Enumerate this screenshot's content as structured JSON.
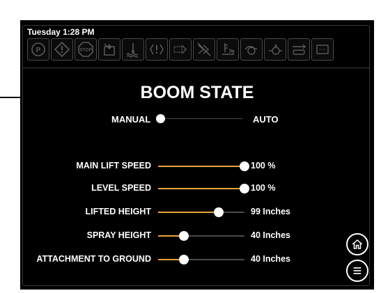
{
  "header": {
    "datetime": "Tuesday 1:28 PM",
    "status_icons": [
      {
        "name": "parking-brake-icon"
      },
      {
        "name": "warning-icon"
      },
      {
        "name": "stop-icon",
        "text": "STOP"
      },
      {
        "name": "fuel-icon"
      },
      {
        "name": "coolant-temp-icon"
      },
      {
        "name": "transmission-icon"
      },
      {
        "name": "hydraulic-icon"
      },
      {
        "name": "hydraulic-disabled-icon"
      },
      {
        "name": "oil-level-icon"
      },
      {
        "name": "engine-icon"
      },
      {
        "name": "oil-pressure-icon"
      },
      {
        "name": "filter-icon"
      },
      {
        "name": "gauge-box-icon"
      }
    ]
  },
  "boom_state": {
    "title": "BOOM STATE",
    "left_label": "MANUAL",
    "right_label": "AUTO",
    "selected": "MANUAL"
  },
  "settings": [
    {
      "label": "MAIN LIFT SPEED",
      "value": "100 %",
      "level": 1.0
    },
    {
      "label": "LEVEL SPEED",
      "value": "100 %",
      "level": 1.0
    },
    {
      "label": "LIFTED HEIGHT",
      "value": "99 Inches",
      "level": 0.7
    },
    {
      "label": "SPRAY HEIGHT",
      "value": "40 Inches",
      "level": 0.3
    },
    {
      "label": "ATTACHMENT TO GROUND",
      "value": "40 Inches",
      "level": 0.3
    }
  ],
  "nav": {
    "home_icon": "home-icon",
    "menu_icon": "menu-icon"
  },
  "colors": {
    "slider_fill": "#e8a23a",
    "background": "#000000",
    "icon_inactive": "#5a5a5a"
  }
}
